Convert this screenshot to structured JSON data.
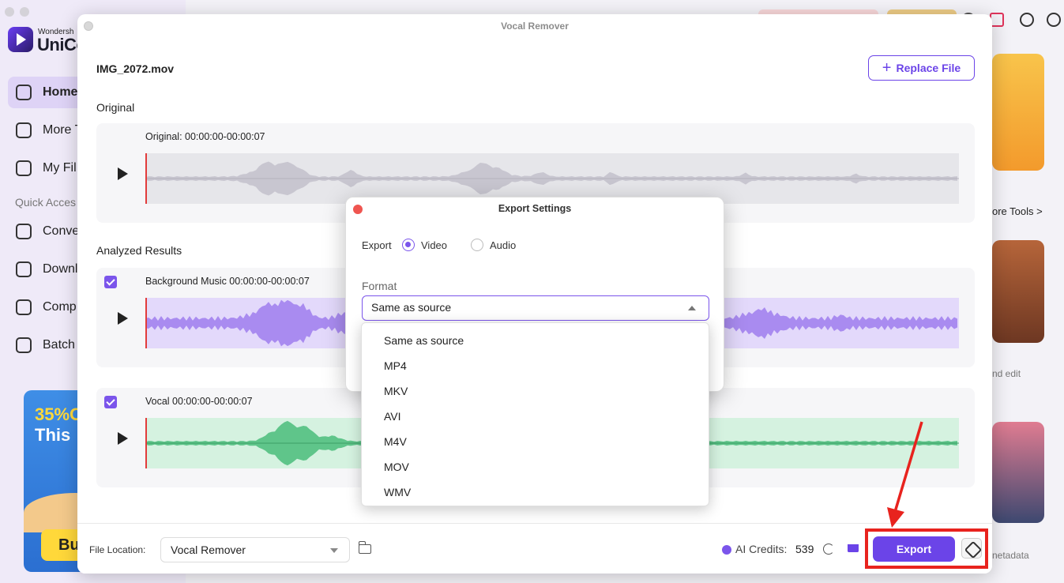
{
  "app": {
    "logo_small": "Wondersh",
    "logo_big": "UniCo",
    "nav": [
      {
        "label": "Home",
        "active": true
      },
      {
        "label": "More T"
      },
      {
        "label": "My Fil"
      }
    ],
    "quick_access": "Quick Acces",
    "quick_items": [
      "Conve",
      "Downl",
      "Comp",
      "Batch"
    ],
    "promo_line1": "35%O",
    "promo_line2": "This",
    "promo_button": "Bu",
    "more_tools": "ore Tools >",
    "side_text_1": "nd edit",
    "side_text_2": "netadata"
  },
  "window": {
    "title": "Vocal Remover",
    "filename": "IMG_2072.mov",
    "replace_label": "Replace File",
    "original_section": "Original",
    "analyzed_section": "Analyzed Results",
    "tracks": [
      {
        "label": "Original: 00:00:00-00:00:07",
        "color": "#c8c6d0",
        "bg": "#e6e6ea",
        "checkbox": false
      },
      {
        "label": "Background Music 00:00:00-00:00:07",
        "color": "#a98bf0",
        "bg": "#e3d9fb",
        "checkbox": true
      },
      {
        "label": "Vocal  00:00:00-00:00:07",
        "color": "#5fc58a",
        "bg": "#d5f2e0",
        "checkbox": true
      }
    ],
    "file_location_label": "File Location:",
    "file_location_value": "Vocal Remover",
    "credits_label": "AI Credits:",
    "credits_value": "539",
    "export_label": "Export"
  },
  "dialog": {
    "title": "Export Settings",
    "export_label": "Export",
    "options": [
      {
        "label": "Video",
        "selected": true
      },
      {
        "label": "Audio",
        "selected": false
      }
    ],
    "format_label": "Format",
    "format_value": "Same as source",
    "format_options": [
      "Same as source",
      "MP4",
      "MKV",
      "AVI",
      "M4V",
      "MOV",
      "WMV"
    ]
  },
  "colors": {
    "accent": "#6b44e8",
    "highlight": "#e8231e"
  }
}
